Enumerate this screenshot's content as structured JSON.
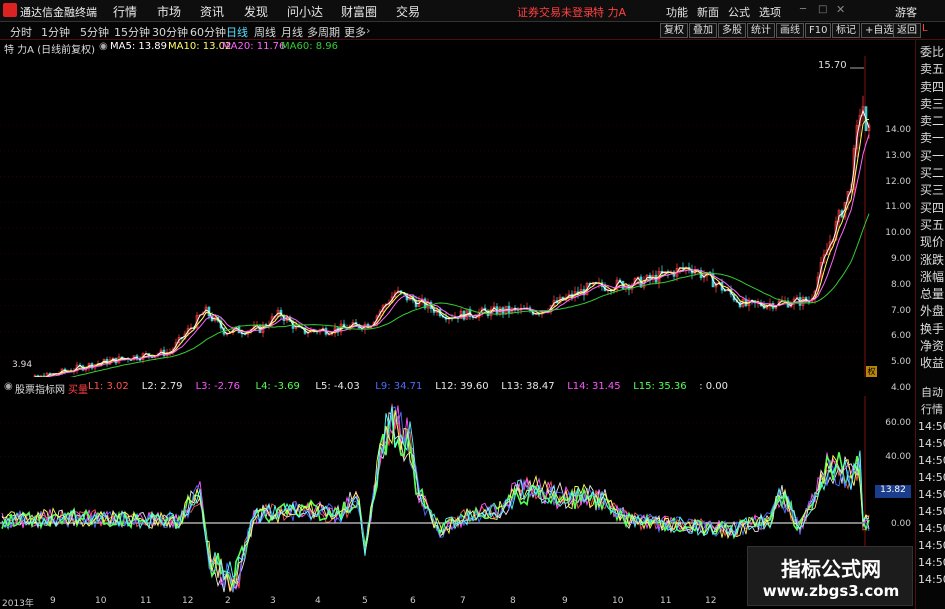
{
  "menubar": {
    "app_title": "通达信金融终端",
    "items": [
      "行情",
      "市场",
      "资讯",
      "发现",
      "问小达",
      "财富圈",
      "交易"
    ],
    "login_status": "证券交易未登录",
    "stock_name": "特 力A",
    "right_items": [
      "功能",
      "新面",
      "公式",
      "选项"
    ],
    "guest": "游客"
  },
  "period_bar": {
    "tabs": [
      "分时",
      "1分钟",
      "5分钟",
      "15分钟",
      "30分钟",
      "60分钟",
      "日线",
      "周线",
      "月线",
      "多周期",
      "更多"
    ],
    "active_tab": "日线",
    "tools": [
      "复权",
      "叠加",
      "多股",
      "统计",
      "画线",
      "F10",
      "标记",
      "+自选",
      "返回"
    ]
  },
  "main_info": {
    "title": "特 力A (日线前复权)",
    "ma5": "MA5: 13.89",
    "ma10": "MA10: 13.02",
    "ma20": "MA20: 11.76",
    "ma60": "MA60: 8.96"
  },
  "sub_info": {
    "title": "股票指标网",
    "tag": "买量",
    "values": [
      {
        "label": "L1: 3.02",
        "color": "#ff5252"
      },
      {
        "label": "L2: 2.79",
        "color": "#e8e8e8"
      },
      {
        "label": "L3: -2.76",
        "color": "#ff55ff"
      },
      {
        "label": "L4: -3.69",
        "color": "#55ff55"
      },
      {
        "label": "L5: -4.03",
        "color": "#e8e8e8"
      },
      {
        "label": "L9: 34.71",
        "color": "#4d6dff"
      },
      {
        "label": "L12: 39.60",
        "color": "#e8e8e8"
      },
      {
        "label": "L13: 38.47",
        "color": "#e8e8e8"
      },
      {
        "label": "L14: 31.45",
        "color": "#ff55ff"
      },
      {
        "label": "L15: 35.36",
        "color": "#55ff55"
      },
      {
        "label": ": 0.00",
        "color": "#e8e8e8"
      }
    ]
  },
  "price_axis": [
    "14.00",
    "13.00",
    "12.00",
    "11.00",
    "10.00",
    "9.00",
    "8.00",
    "7.00",
    "6.00",
    "5.00",
    "4.00"
  ],
  "sub_axis": [
    "60.00",
    "40.00",
    "20.00",
    "0.00",
    "-20.00"
  ],
  "sub_current": "13.82",
  "annotations": {
    "high": "15.70",
    "low": "3.94"
  },
  "x_axis": [
    "2013年",
    "9",
    "10",
    "11",
    "12",
    "2",
    "3",
    "4",
    "5",
    "6",
    "7",
    "8",
    "9",
    "10",
    "11",
    "12"
  ],
  "side_panel": [
    "委比",
    "卖五",
    "卖四",
    "卖三",
    "卖二",
    "卖一",
    "买一",
    "买二",
    "买三",
    "买四",
    "买五",
    "现价",
    "涨跌",
    "涨幅",
    "总量",
    "外盘",
    "换手",
    "净资",
    "收益"
  ],
  "side_panel2": [
    "自动",
    "行情",
    "14:50",
    "14:50",
    "14:50",
    "14:50",
    "14:50",
    "14:50",
    "14:50",
    "14:50",
    "14:50",
    "14:50"
  ],
  "watermark": {
    "title": "指标公式网",
    "url": "www.zbgs3.com"
  },
  "colors": {
    "up": "#ff3b3b",
    "down": "#3fd0d0",
    "ma5": "#ffffff",
    "ma10": "#ffff66",
    "ma20": "#ff66ff",
    "ma60": "#33cc33"
  }
}
